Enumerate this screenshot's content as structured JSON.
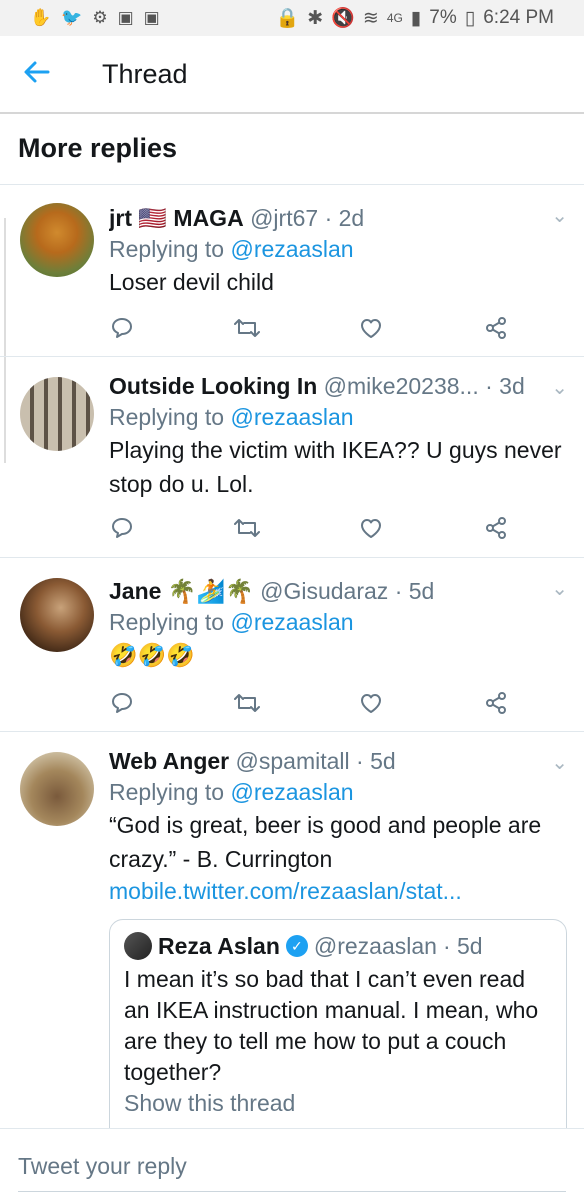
{
  "status_bar": {
    "battery": "7%",
    "time": "6:24 PM",
    "network": "4G"
  },
  "header": {
    "title": "Thread"
  },
  "section": {
    "title": "More replies"
  },
  "replies": [
    {
      "name": "jrt 🇺🇸 MAGA",
      "handle": "@jrt67",
      "time": "· 2d",
      "replying_prefix": "Replying to",
      "replying_to": "@rezaaslan",
      "text": "Loser devil child"
    },
    {
      "name": "Outside Looking In",
      "handle": "@mike20238...",
      "time": "· 3d",
      "replying_prefix": "Replying to",
      "replying_to": "@rezaaslan",
      "text": "Playing the victim with IKEA?? U guys never stop do u. Lol."
    },
    {
      "name": "Jane 🌴🏄🌴",
      "handle": "@Gisudaraz",
      "time": "· 5d",
      "replying_prefix": "Replying to",
      "replying_to": "@rezaaslan",
      "text": "🤣🤣🤣"
    },
    {
      "name": "Web Anger",
      "handle": "@spamitall",
      "time": "· 5d",
      "replying_prefix": "Replying to",
      "replying_to": "@rezaaslan",
      "text": "“God is great, beer is good and people are crazy.” - B. Currington",
      "link": "mobile.twitter.com/rezaaslan/stat..."
    }
  ],
  "quoted_tweet": {
    "name": "Reza Aslan",
    "handle": "@rezaaslan",
    "time": "· 5d",
    "text": "I mean it’s so bad that I can’t even read an IKEA instruction manual. I mean, who are they to tell me how to put a couch together?",
    "show_thread": "Show this thread"
  },
  "compose": {
    "placeholder": "Tweet your reply"
  }
}
